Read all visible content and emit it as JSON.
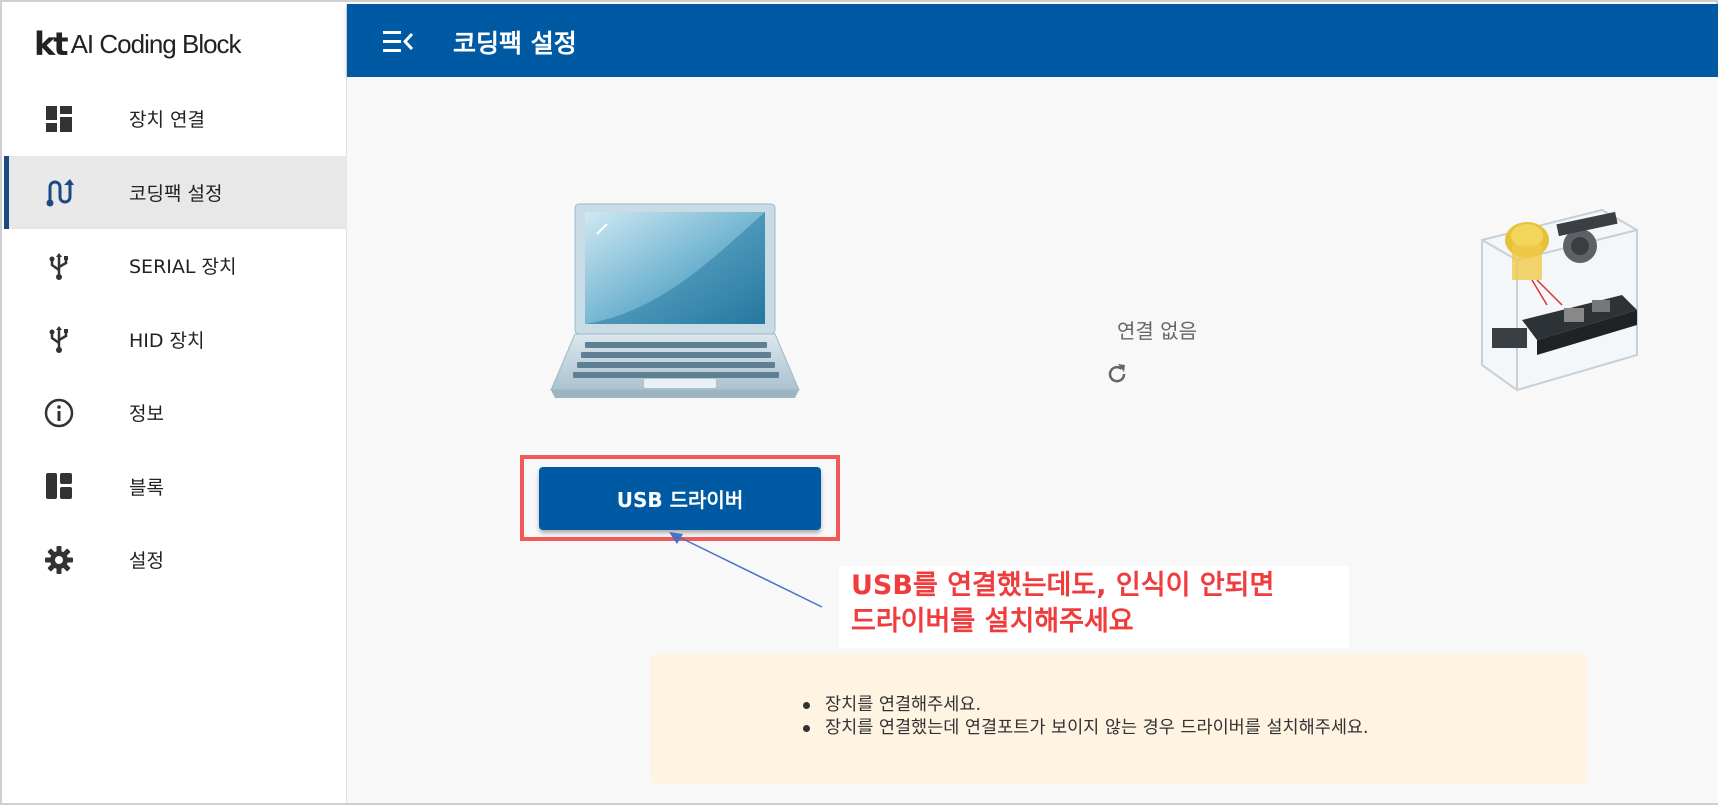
{
  "app": {
    "logo_brand": "kt",
    "logo_text": "AI Coding Block"
  },
  "sidebar": {
    "items": [
      {
        "label": "장치 연결",
        "icon": "dashboard-icon",
        "active": false
      },
      {
        "label": "코딩팩 설정",
        "icon": "route-icon",
        "active": true
      },
      {
        "label": "SERIAL 장치",
        "icon": "usb-icon",
        "active": false
      },
      {
        "label": "HID 장치",
        "icon": "usb-icon",
        "active": false
      },
      {
        "label": "정보",
        "icon": "info-icon",
        "active": false
      },
      {
        "label": "블록",
        "icon": "blocks-icon",
        "active": false
      },
      {
        "label": "설정",
        "icon": "gear-icon",
        "active": false
      }
    ]
  },
  "header": {
    "title": "코딩팩 설정",
    "menu_icon": "menu-collapse-icon"
  },
  "main": {
    "connection_status": "연결 없음",
    "refresh_icon": "refresh-icon",
    "usb_button_label": "USB 드라이버",
    "callout": {
      "line1": "USB를 연결했는데도, 인식이 안되면",
      "line2": "드라이버를 설치해주세요"
    },
    "info": {
      "items": [
        "장치를 연결해주세요.",
        "장치를 연결했는데 연결포트가 보이지 않는 경우 드라이버를 설치해주세요."
      ]
    }
  },
  "colors": {
    "header_bg": "#005aa3",
    "button_bg": "#005aa3",
    "active_indicator": "#1b4a82",
    "highlight_red": "#f05a5a",
    "callout_text": "#f03c3c",
    "info_bg": "#fff3e2"
  }
}
